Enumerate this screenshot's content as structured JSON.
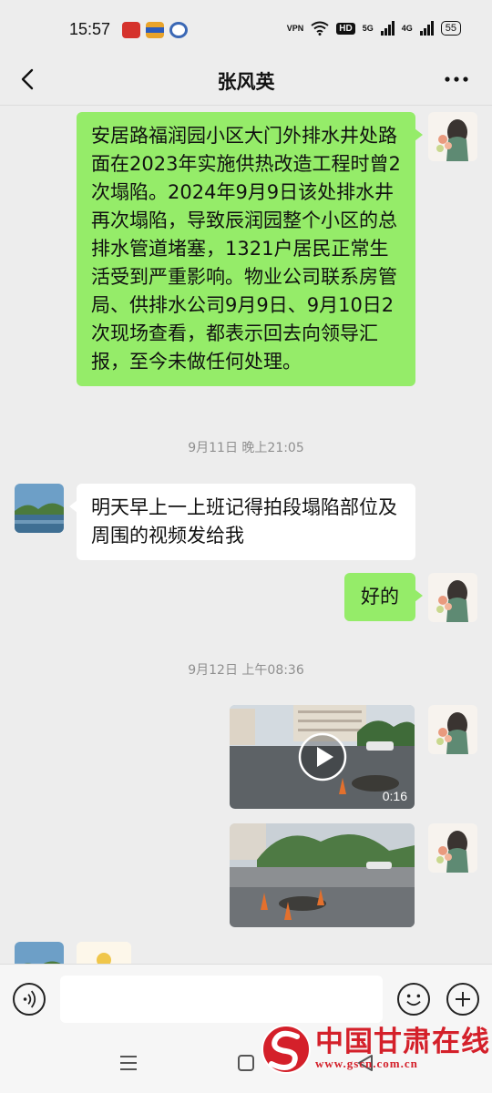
{
  "status_bar": {
    "time": "15:57",
    "vpn": "VPN",
    "hd": "HD",
    "sig1_label": "5G",
    "sig2_label": "4G",
    "battery": "55"
  },
  "header": {
    "title": "张风英",
    "back_icon": "chevron-left-icon",
    "more_icon": "more-horizontal-icon"
  },
  "messages": {
    "m1": {
      "text": "安居路福润园小区大门外排水井处路面在2023年实施供热改造工程时曾2次塌陷。2024年9月9日该处排水井再次塌陷，导致辰润园整个小区的总排水管道堵塞，1321户居民正常生活受到严重影响。物业公司联系房管局、供排水公司9月9日、9月10日2次现场查看，都表示回去向领导汇报，至今未做任何处理。"
    },
    "ts1": "9月11日 晚上21:05",
    "m2": {
      "text": "明天早上一上班记得拍段塌陷部位及周围的视频发给我"
    },
    "m3": {
      "text": "好的"
    },
    "ts2": "9月12日 上午08:36",
    "m4": {
      "type": "video",
      "duration": "0:16"
    },
    "m5": {
      "type": "image"
    }
  },
  "input_bar": {
    "voice_icon": "voice-icon",
    "emoji_icon": "emoji-icon",
    "plus_icon": "plus-icon",
    "placeholder": ""
  },
  "nav_bar": {
    "menu_icon": "menu-icon",
    "home_icon": "home-icon",
    "back_icon": "back-triangle-icon"
  },
  "watermark": {
    "text": "中国甘肃在线",
    "url": "www.gscn.com.cn"
  },
  "colors": {
    "my_bubble": "#95ec69",
    "other_bubble": "#ffffff",
    "background": "#ededed",
    "watermark_red": "#d4202a"
  }
}
